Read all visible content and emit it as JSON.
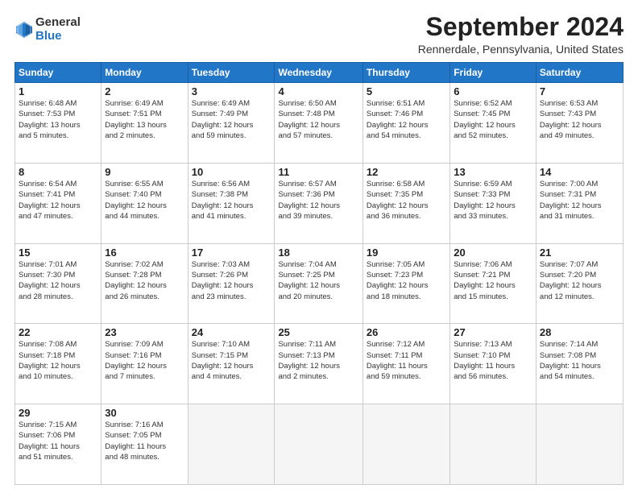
{
  "logo": {
    "general": "General",
    "blue": "Blue"
  },
  "header": {
    "title": "September 2024",
    "location": "Rennerdale, Pennsylvania, United States"
  },
  "days_of_week": [
    "Sunday",
    "Monday",
    "Tuesday",
    "Wednesday",
    "Thursday",
    "Friday",
    "Saturday"
  ],
  "weeks": [
    [
      {
        "day": "1",
        "info": "Sunrise: 6:48 AM\nSunset: 7:53 PM\nDaylight: 13 hours\nand 5 minutes."
      },
      {
        "day": "2",
        "info": "Sunrise: 6:49 AM\nSunset: 7:51 PM\nDaylight: 13 hours\nand 2 minutes."
      },
      {
        "day": "3",
        "info": "Sunrise: 6:49 AM\nSunset: 7:49 PM\nDaylight: 12 hours\nand 59 minutes."
      },
      {
        "day": "4",
        "info": "Sunrise: 6:50 AM\nSunset: 7:48 PM\nDaylight: 12 hours\nand 57 minutes."
      },
      {
        "day": "5",
        "info": "Sunrise: 6:51 AM\nSunset: 7:46 PM\nDaylight: 12 hours\nand 54 minutes."
      },
      {
        "day": "6",
        "info": "Sunrise: 6:52 AM\nSunset: 7:45 PM\nDaylight: 12 hours\nand 52 minutes."
      },
      {
        "day": "7",
        "info": "Sunrise: 6:53 AM\nSunset: 7:43 PM\nDaylight: 12 hours\nand 49 minutes."
      }
    ],
    [
      {
        "day": "8",
        "info": "Sunrise: 6:54 AM\nSunset: 7:41 PM\nDaylight: 12 hours\nand 47 minutes."
      },
      {
        "day": "9",
        "info": "Sunrise: 6:55 AM\nSunset: 7:40 PM\nDaylight: 12 hours\nand 44 minutes."
      },
      {
        "day": "10",
        "info": "Sunrise: 6:56 AM\nSunset: 7:38 PM\nDaylight: 12 hours\nand 41 minutes."
      },
      {
        "day": "11",
        "info": "Sunrise: 6:57 AM\nSunset: 7:36 PM\nDaylight: 12 hours\nand 39 minutes."
      },
      {
        "day": "12",
        "info": "Sunrise: 6:58 AM\nSunset: 7:35 PM\nDaylight: 12 hours\nand 36 minutes."
      },
      {
        "day": "13",
        "info": "Sunrise: 6:59 AM\nSunset: 7:33 PM\nDaylight: 12 hours\nand 33 minutes."
      },
      {
        "day": "14",
        "info": "Sunrise: 7:00 AM\nSunset: 7:31 PM\nDaylight: 12 hours\nand 31 minutes."
      }
    ],
    [
      {
        "day": "15",
        "info": "Sunrise: 7:01 AM\nSunset: 7:30 PM\nDaylight: 12 hours\nand 28 minutes."
      },
      {
        "day": "16",
        "info": "Sunrise: 7:02 AM\nSunset: 7:28 PM\nDaylight: 12 hours\nand 26 minutes."
      },
      {
        "day": "17",
        "info": "Sunrise: 7:03 AM\nSunset: 7:26 PM\nDaylight: 12 hours\nand 23 minutes."
      },
      {
        "day": "18",
        "info": "Sunrise: 7:04 AM\nSunset: 7:25 PM\nDaylight: 12 hours\nand 20 minutes."
      },
      {
        "day": "19",
        "info": "Sunrise: 7:05 AM\nSunset: 7:23 PM\nDaylight: 12 hours\nand 18 minutes."
      },
      {
        "day": "20",
        "info": "Sunrise: 7:06 AM\nSunset: 7:21 PM\nDaylight: 12 hours\nand 15 minutes."
      },
      {
        "day": "21",
        "info": "Sunrise: 7:07 AM\nSunset: 7:20 PM\nDaylight: 12 hours\nand 12 minutes."
      }
    ],
    [
      {
        "day": "22",
        "info": "Sunrise: 7:08 AM\nSunset: 7:18 PM\nDaylight: 12 hours\nand 10 minutes."
      },
      {
        "day": "23",
        "info": "Sunrise: 7:09 AM\nSunset: 7:16 PM\nDaylight: 12 hours\nand 7 minutes."
      },
      {
        "day": "24",
        "info": "Sunrise: 7:10 AM\nSunset: 7:15 PM\nDaylight: 12 hours\nand 4 minutes."
      },
      {
        "day": "25",
        "info": "Sunrise: 7:11 AM\nSunset: 7:13 PM\nDaylight: 12 hours\nand 2 minutes."
      },
      {
        "day": "26",
        "info": "Sunrise: 7:12 AM\nSunset: 7:11 PM\nDaylight: 11 hours\nand 59 minutes."
      },
      {
        "day": "27",
        "info": "Sunrise: 7:13 AM\nSunset: 7:10 PM\nDaylight: 11 hours\nand 56 minutes."
      },
      {
        "day": "28",
        "info": "Sunrise: 7:14 AM\nSunset: 7:08 PM\nDaylight: 11 hours\nand 54 minutes."
      }
    ],
    [
      {
        "day": "29",
        "info": "Sunrise: 7:15 AM\nSunset: 7:06 PM\nDaylight: 11 hours\nand 51 minutes."
      },
      {
        "day": "30",
        "info": "Sunrise: 7:16 AM\nSunset: 7:05 PM\nDaylight: 11 hours\nand 48 minutes."
      },
      {
        "day": "",
        "info": ""
      },
      {
        "day": "",
        "info": ""
      },
      {
        "day": "",
        "info": ""
      },
      {
        "day": "",
        "info": ""
      },
      {
        "day": "",
        "info": ""
      }
    ]
  ]
}
